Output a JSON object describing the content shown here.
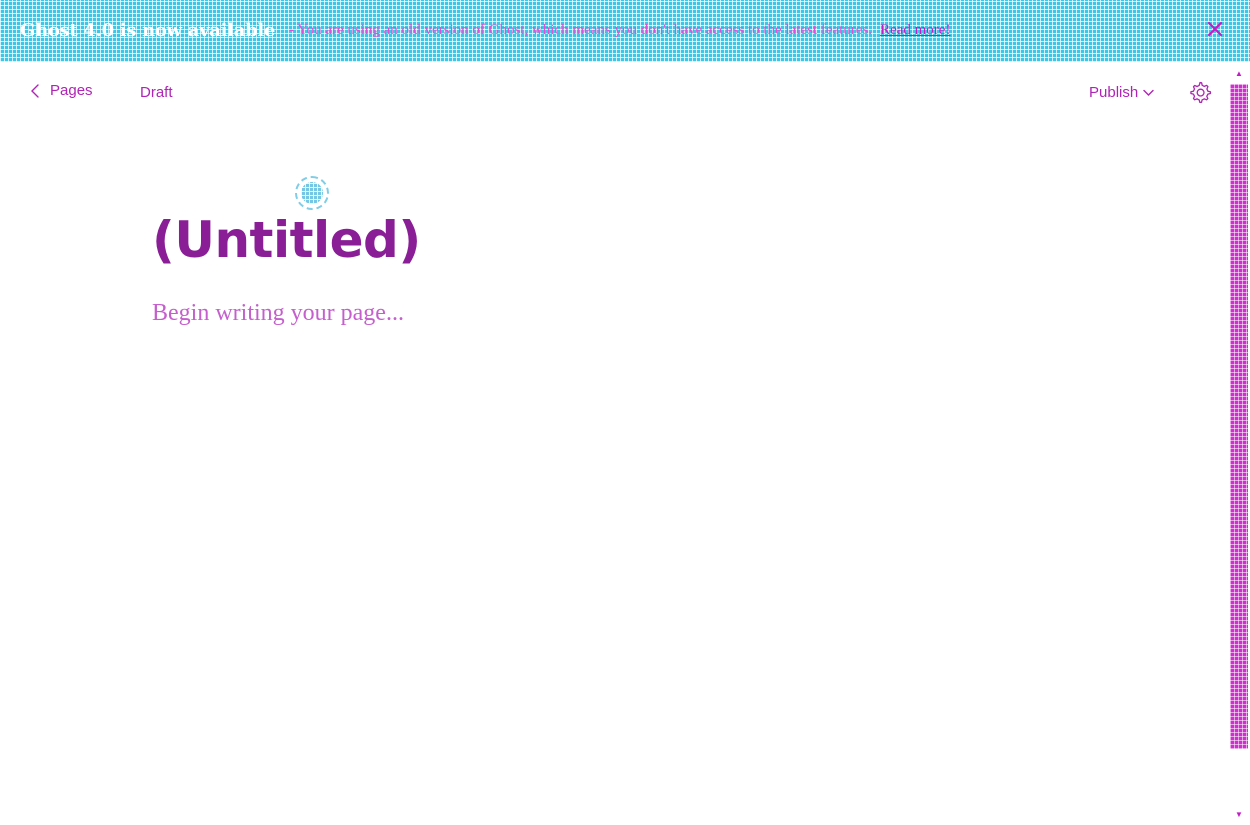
{
  "banner": {
    "title": "Ghost 4.0 is now available",
    "message_prefix": "- You are using an old version of Ghost, which means you don't have access to the latest features.",
    "link_label": "Read more!",
    "close_icon": "close-icon"
  },
  "topbar": {
    "back_label": "Pages",
    "back_icon": "chevron-left-icon",
    "status": "Draft",
    "publish_label": "Publish",
    "publish_icon": "chevron-down-icon",
    "settings_icon": "gear-icon"
  },
  "editor": {
    "feature_image_icon": "image-add-icon",
    "title": "(Untitled)",
    "body_placeholder": "Begin writing your page..."
  },
  "colors": {
    "banner_bg": "#3ec6e6",
    "accent": "#b023b6",
    "title": "#8a1e96",
    "scroll_thumb": "#d12ed0"
  }
}
